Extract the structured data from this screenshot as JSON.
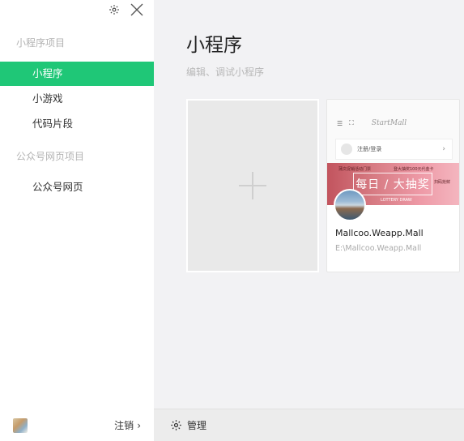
{
  "sidebar": {
    "sections": [
      {
        "label": "小程序项目",
        "items": [
          "小程序",
          "小游戏",
          "代码片段"
        ]
      },
      {
        "label": "公众号网页项目",
        "items": [
          "公众号网页"
        ]
      }
    ],
    "active_item": "小程序",
    "footer": {
      "logout_label": "注销",
      "logout_arrow": "›"
    }
  },
  "main": {
    "title": "小程序",
    "subtitle": "编辑、调试小程序",
    "project": {
      "name": "Mallcoo.Weapp.Mall",
      "path": "E:\\Mallcoo.Weapp.Mall",
      "preview": {
        "logo_text": "StartMall",
        "login_text": "注册/登录",
        "banner_left": "蒲文促销活动门票",
        "banner_mid": "登大抽奖100元代金卡",
        "banner_right": "扫码抢鲜",
        "banner_main": "每日 / 大抽奖",
        "banner_sub": "LOTTERY DRAW"
      }
    },
    "bottom": {
      "manage_label": "管理"
    }
  },
  "colors": {
    "accent": "#1fc777",
    "sidebar_bg": "#ffffff",
    "main_bg": "#f2f2f4"
  }
}
